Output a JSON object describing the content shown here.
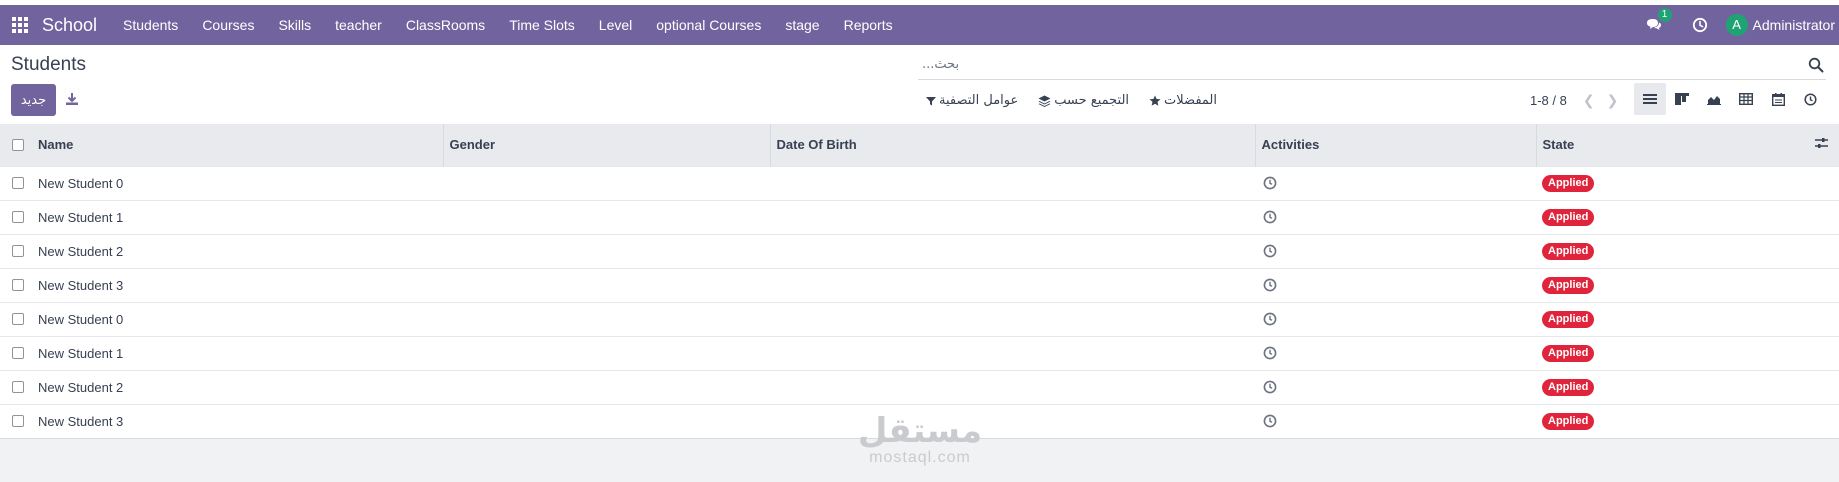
{
  "navbar": {
    "brand": "School",
    "menu": [
      {
        "label": "Students"
      },
      {
        "label": "Courses"
      },
      {
        "label": "Skills"
      },
      {
        "label": "teacher"
      },
      {
        "label": "ClassRooms"
      },
      {
        "label": "Time Slots"
      },
      {
        "label": "Level"
      },
      {
        "label": "optional Courses"
      },
      {
        "label": "stage"
      },
      {
        "label": "Reports"
      }
    ],
    "messages_count": "1",
    "avatar_letter": "A",
    "user_name": "Administrator",
    "accent_color": "#71639e"
  },
  "control_panel": {
    "title": "Students",
    "new_label": "جديد",
    "search_placeholder": "بحث...",
    "filters_label": "عوامل التصفية",
    "groupby_label": "التجميع حسب",
    "favorites_label": "المفضلات",
    "pager": "1-8 / 8"
  },
  "table": {
    "columns": {
      "name": "Name",
      "gender": "Gender",
      "dob": "Date Of Birth",
      "activities": "Activities",
      "state": "State"
    },
    "rows": [
      {
        "name": "New Student 0",
        "gender": "",
        "dob": "",
        "state": "Applied"
      },
      {
        "name": "New Student 1",
        "gender": "",
        "dob": "",
        "state": "Applied"
      },
      {
        "name": "New Student 2",
        "gender": "",
        "dob": "",
        "state": "Applied"
      },
      {
        "name": "New Student 3",
        "gender": "",
        "dob": "",
        "state": "Applied"
      },
      {
        "name": "New Student 0",
        "gender": "",
        "dob": "",
        "state": "Applied"
      },
      {
        "name": "New Student 1",
        "gender": "",
        "dob": "",
        "state": "Applied"
      },
      {
        "name": "New Student 2",
        "gender": "",
        "dob": "",
        "state": "Applied"
      },
      {
        "name": "New Student 3",
        "gender": "",
        "dob": "",
        "state": "Applied"
      }
    ],
    "state_color": "#e0243b"
  },
  "watermark": {
    "arabic": "مستقل",
    "latin": "mostaql.com"
  }
}
